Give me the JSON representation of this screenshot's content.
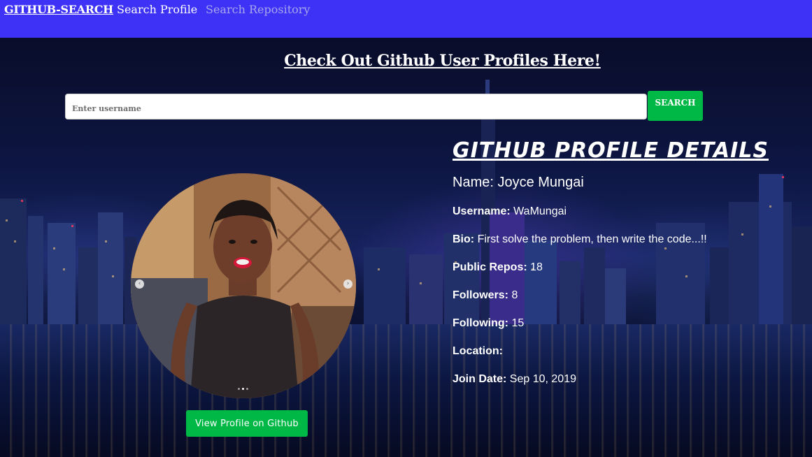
{
  "navbar": {
    "brand": "GITHUB-SEARCH",
    "links": [
      {
        "label": "Search Profile"
      },
      {
        "label": "Search Repository"
      }
    ]
  },
  "headline": "Check Out Github User Profiles Here!",
  "search": {
    "placeholder": "Enter username",
    "value": "",
    "button_label": "SEARCH"
  },
  "profile": {
    "section_title": "GITHUB PROFILE DETAILS",
    "name_label": "Name:",
    "name_value": "Joyce Mungai",
    "rows": [
      {
        "label": "Username:",
        "value": "WaMungai"
      },
      {
        "label": "Bio:",
        "value": "First solve the problem, then write the code...!!"
      },
      {
        "label": "Public Repos:",
        "value": "18"
      },
      {
        "label": "Followers:",
        "value": "8"
      },
      {
        "label": "Following:",
        "value": "15"
      },
      {
        "label": "Location:",
        "value": ""
      },
      {
        "label": "Join Date:",
        "value": "Sep 10, 2019"
      }
    ],
    "view_button_label": "View Profile on Github"
  },
  "carousel": {
    "prev_icon": "chevron-left-icon",
    "next_icon": "chevron-right-icon",
    "prev_glyph": "‹",
    "next_glyph": "›"
  },
  "colors": {
    "navbar": "#3d32f5",
    "accent_green": "#00b845",
    "inactive_link": "#a8a6ee",
    "text": "#ffffff"
  }
}
